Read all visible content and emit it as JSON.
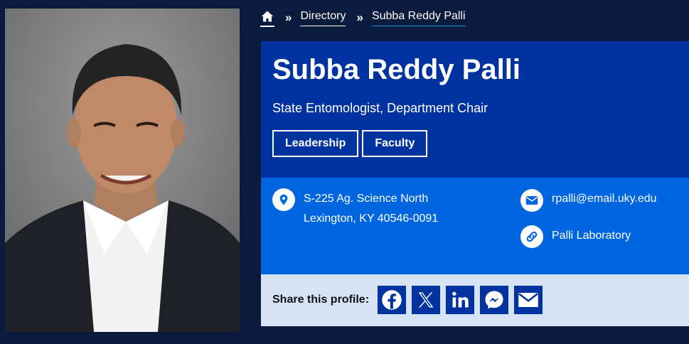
{
  "breadcrumb": {
    "home_icon": "home-icon",
    "separator": "»",
    "directory": "Directory",
    "current": "Subba Reddy Palli"
  },
  "profile": {
    "name": "Subba Reddy Palli",
    "title": "State Entomologist, Department Chair",
    "tags": [
      "Leadership",
      "Faculty"
    ]
  },
  "contact": {
    "address_line1": "S-225 Ag. Science North",
    "address_line2": "Lexington, KY 40546-0091",
    "email": "rpalli@email.uky.edu",
    "lab_link": "Palli Laboratory"
  },
  "share": {
    "label": "Share this profile:",
    "icons": [
      "facebook-icon",
      "x-icon",
      "linkedin-icon",
      "messenger-icon",
      "email-icon"
    ]
  },
  "colors": {
    "page_bg": "#0b1b3d",
    "header_bg": "#0033a0",
    "contact_bg": "#0066e0",
    "share_bg": "#d6e2f5",
    "accent": "#1e90ff"
  }
}
